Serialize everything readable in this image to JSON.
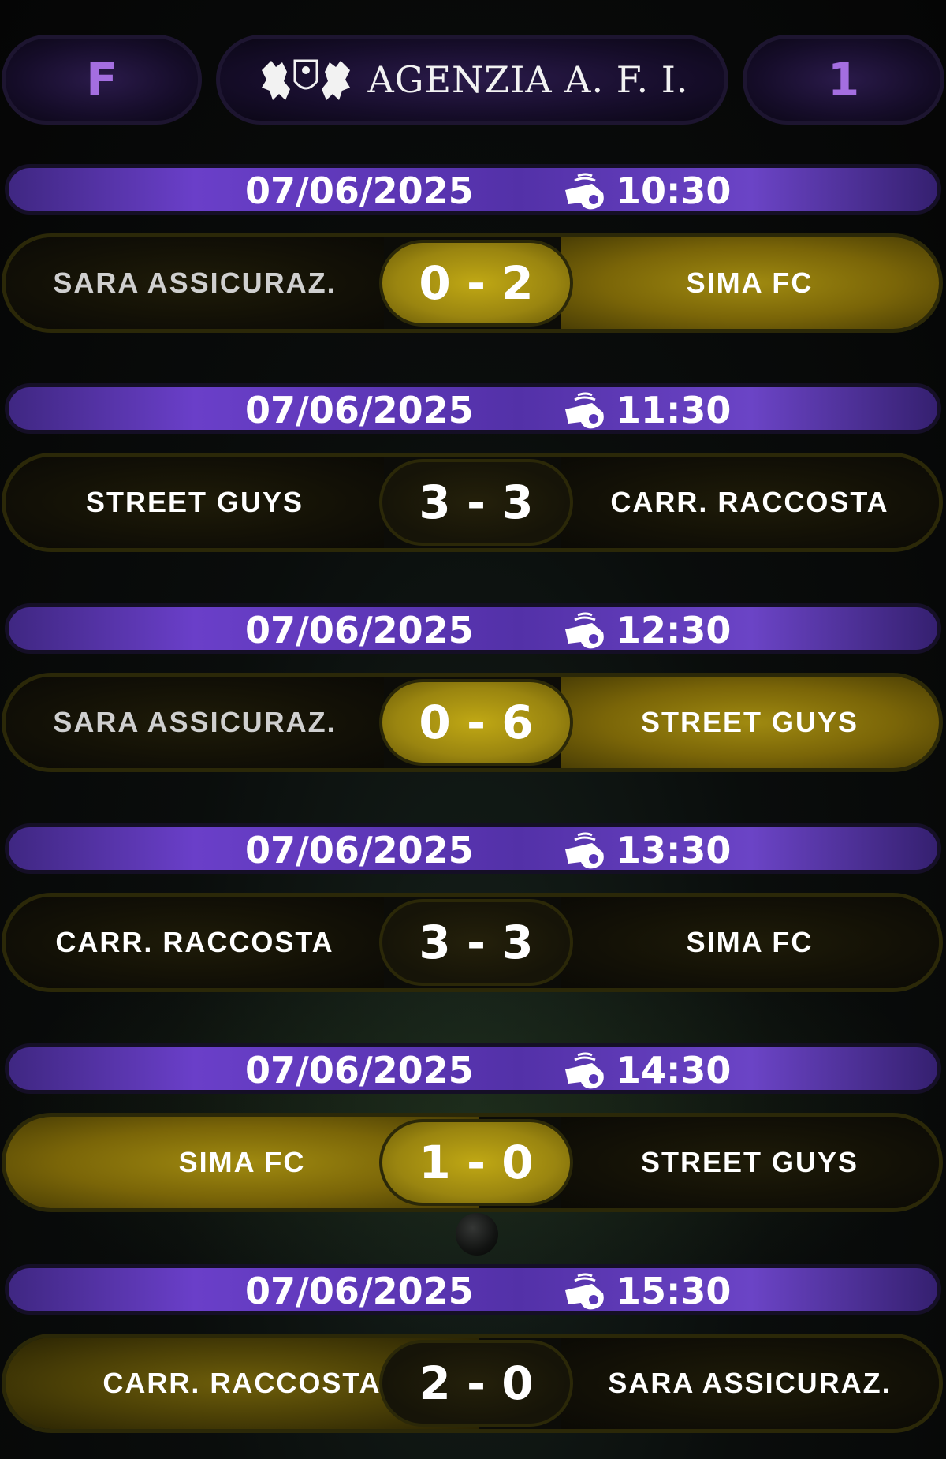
{
  "header": {
    "left_letter": "F",
    "brand": "AGENZIA A. F. I.",
    "right_number": "1",
    "accent_color": "#a46ee0"
  },
  "matches": [
    {
      "date": "07/06/2025",
      "time": "10:30",
      "home": "SARA ASSICURAZ.",
      "score": "0 - 2",
      "away": "SIMA FC"
    },
    {
      "date": "07/06/2025",
      "time": "11:30",
      "home": "STREET GUYS",
      "score": "3 - 3",
      "away": "CARR. RACCOSTA"
    },
    {
      "date": "07/06/2025",
      "time": "12:30",
      "home": "SARA ASSICURAZ.",
      "score": "0 - 6",
      "away": "STREET GUYS"
    },
    {
      "date": "07/06/2025",
      "time": "13:30",
      "home": "CARR. RACCOSTA",
      "score": "3 - 3",
      "away": "SIMA FC"
    },
    {
      "date": "07/06/2025",
      "time": "14:30",
      "home": "SIMA FC",
      "score": "1 - 0",
      "away": "STREET GUYS"
    },
    {
      "date": "07/06/2025",
      "time": "15:30",
      "home": "CARR. RACCOSTA",
      "score": "2 - 0",
      "away": "SARA ASSICURAZ."
    }
  ],
  "icons": {
    "whistle": "whistle-icon",
    "crest": "lion-crest-logo"
  },
  "colors": {
    "date_bar": "#5a36b8",
    "gold": "#9a8510",
    "dark": "#141208"
  }
}
